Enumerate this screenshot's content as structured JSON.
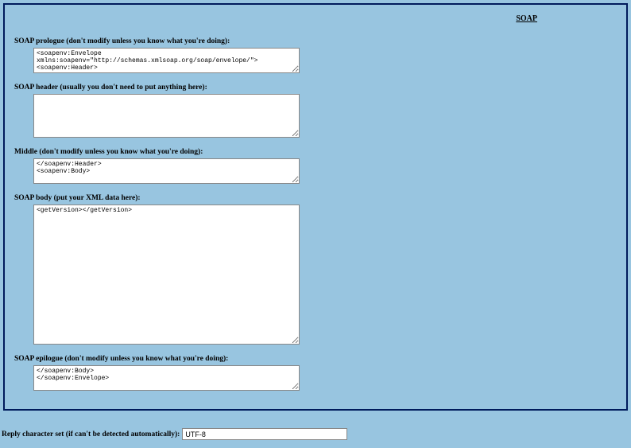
{
  "header": {
    "title": "SOAP"
  },
  "fields": {
    "prologue": {
      "label": "SOAP prologue (don't modify unless you know what you're doing):",
      "value": "<soapenv:Envelope xmlns:soapenv=\"http://schemas.xmlsoap.org/soap/envelope/\">\n<soapenv:Header>"
    },
    "soapHeader": {
      "label": "SOAP header (usually you don't need to put anything here):",
      "value": ""
    },
    "middle": {
      "label": "Middle (don't modify unless you know what you're doing):",
      "value": "</soapenv:Header>\n<soapenv:Body>"
    },
    "body": {
      "label": "SOAP body (put your XML data here):",
      "value": "<getVersion></getVersion>"
    },
    "epilogue": {
      "label": "SOAP epilogue (don't modify unless you know what you're doing):",
      "value": "</soapenv:Body>\n</soapenv:Envelope>"
    }
  },
  "charset": {
    "label": "Reply character set (if can't be detected automatically):",
    "value": "UTF-8"
  }
}
